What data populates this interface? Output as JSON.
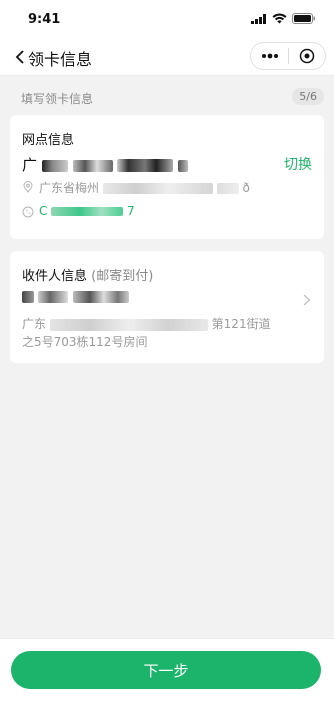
{
  "status_bar": {
    "time": "9:41"
  },
  "navbar": {
    "title": "领卡信息",
    "back_icon": "chevron-left-icon",
    "more_icon": "more-dots-icon",
    "close_icon": "target-close-icon"
  },
  "section": {
    "label": "填写领卡信息",
    "step": "5/6"
  },
  "outlet_card": {
    "title": "网点信息",
    "name": "广",
    "switch_label": "切换",
    "address_prefix": "广东省梅州",
    "address_suffix": "ð",
    "phone_prefix": "C",
    "phone_suffix": "7"
  },
  "recipient_card": {
    "title": "收件人信息",
    "subtitle": "(邮寄到付)",
    "address_prefix": "广东",
    "address_mid": "第121街道",
    "address_line2": "之5号703栋112号房间"
  },
  "footer": {
    "next_label": "下一步"
  },
  "colors": {
    "accent": "#20b46c",
    "button": "#1cb46b",
    "muted": "#9a9a9a"
  }
}
